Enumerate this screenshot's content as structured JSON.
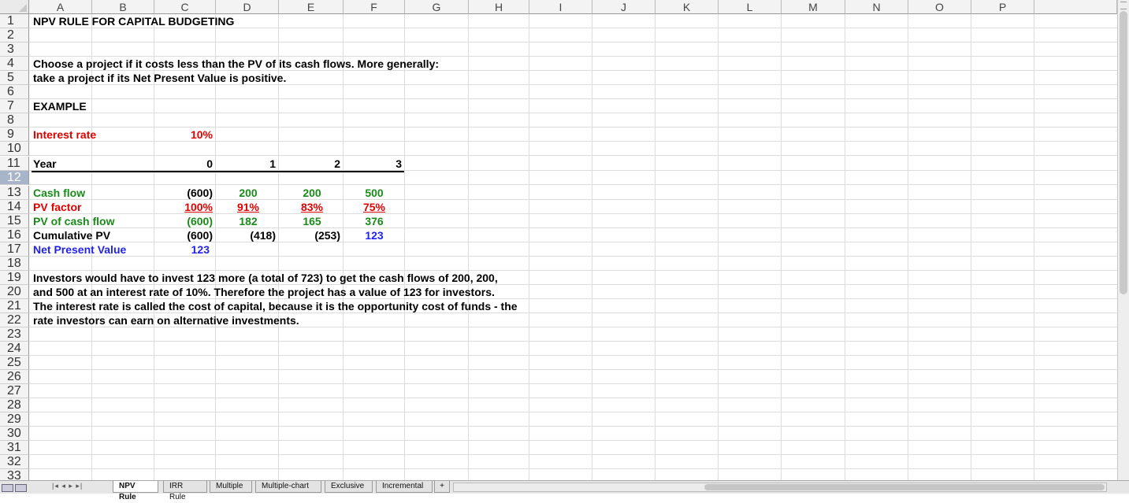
{
  "columns": [
    "A",
    "B",
    "C",
    "D",
    "E",
    "F",
    "G",
    "H",
    "I",
    "J",
    "K",
    "L",
    "M",
    "N",
    "O",
    "P"
  ],
  "rows": [
    "1",
    "2",
    "3",
    "4",
    "5",
    "6",
    "7",
    "8",
    "9",
    "10",
    "11",
    "12",
    "13",
    "14",
    "15",
    "16",
    "17",
    "18",
    "19",
    "20",
    "21",
    "22",
    "23",
    "24",
    "25",
    "26",
    "27",
    "28",
    "29",
    "30",
    "31",
    "32",
    "33"
  ],
  "selected_row": "12",
  "cells": {
    "A1": "NPV RULE FOR CAPITAL BUDGETING",
    "A4": "Choose a project if it costs less than the PV of its cash flows.  More generally:",
    "A5": "take a project if its Net Present Value is positive.",
    "A7": "EXAMPLE",
    "A9": "Interest rate",
    "B9": "10%",
    "A11": "Year",
    "B11": "0",
    "C11": "1",
    "D11": "2",
    "E11": "3",
    "A13": "Cash flow",
    "B13": "(600)",
    "C13": "200",
    "D13": "200",
    "E13": "500",
    "A14": "PV factor",
    "B14": "100%",
    "C14": "91%",
    "D14": "83%",
    "E14": "75%",
    "A15": "PV of cash flow",
    "B15": "(600)",
    "C15": "182",
    "D15": "165",
    "E15": "376",
    "A16": "Cumulative PV",
    "B16": "(600)",
    "C16": "(418)",
    "D16": "(253)",
    "E16": "123",
    "A17": "Net Present Value",
    "B17": "123",
    "A19": "Investors would have to invest 123 more (a total of 723) to get the cash flows of 200, 200,",
    "A20": "and 500 at an interest rate of 10%.  Therefore the project has a value of 123 for investors.",
    "A21": "The interest rate is called the cost of capital, because it is the opportunity cost of funds - the",
    "A22": "rate investors can earn on alternative investments."
  },
  "tabs": [
    "NPV Rule",
    "IRR Rule",
    "Multiple",
    "Multiple-chart",
    "Exclusive",
    "Incremental"
  ],
  "active_tab": "NPV Rule",
  "add_sheet": "+",
  "tab_nav": "|◂ ◂ ▸ ▸|",
  "colors": {
    "label_red": "#e00000",
    "label_green": "#1a8a1a",
    "label_blue": "#2222ee",
    "selected_row": "#a7b4c9"
  }
}
